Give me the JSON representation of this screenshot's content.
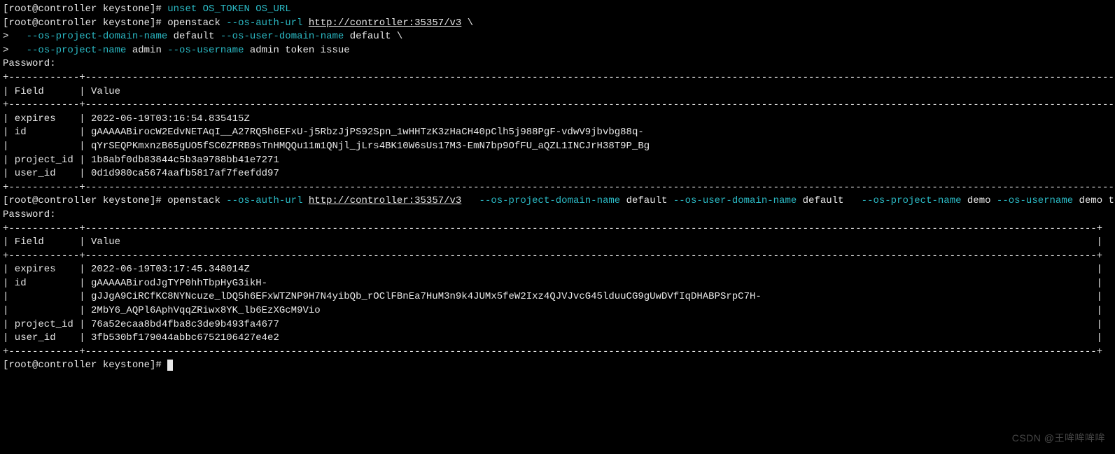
{
  "prompt1": "[root@controller keystone]# ",
  "prompt2": ">   ",
  "cmd_unset": "unset OS_TOKEN OS_URL",
  "cmd1_part1a": "openstack ",
  "cmd1_flag1": "--os-auth-url",
  "cmd1_space1": " ",
  "cmd1_url": "http://controller:35357/v3",
  "cmd1_bs1": " \\",
  "cmd1_flag2": "--os-project-domain-name",
  "cmd1_val2": " default ",
  "cmd1_flag3": "--os-user-domain-name",
  "cmd1_val3": " default \\",
  "cmd1_flag4": "--os-project-name",
  "cmd1_val4": " admin ",
  "cmd1_flag5": "--os-username",
  "cmd1_val5": " admin token issue",
  "password_label": "Password: ",
  "table1": {
    "sep_top": "+------------+-----------------------------------------------------------------------------------------------------------------------------------------------------------------------------------------+",
    "header": "| Field      | Value                                                                                                                                                                                   |",
    "sep_mid": "+------------+-----------------------------------------------------------------------------------------------------------------------------------------------------------------------------------------+",
    "row_exp": "| expires    | 2022-06-19T03:16:54.835415Z                                                                                                                                                             |",
    "row_id1": "| id         | gAAAAABirocW2EdvNETAqI__A27RQ5h6EFxU-j5RbzJjPS92Spn_1wHHTzK3zHaCH40pClh5j988PgF-vdwV9jbvbg88q-                                                                                          |",
    "row_id2": "|            | qYrSEQPKmxnzB65gUO5fSC0ZPRB9sTnHMQQu11m1QNjl_jLrs4BK10W6sUs17M3-EmN7bp9OfFU_aQZL1INCJrH38T9P_Bg                                                                                         |",
    "row_pid": "| project_id | 1b8abf0db83844c5b3a9788bb41e7271                                                                                                                                                        |",
    "row_uid": "| user_id    | 0d1d980ca5674aafb5817af7feefdd97                                                                                                                                                        |",
    "sep_bot": "+------------+-----------------------------------------------------------------------------------------------------------------------------------------------------------------------------------------+"
  },
  "cmd2_part1": "openstack ",
  "cmd2_flag1": "--os-auth-url",
  "cmd2_sp1": " ",
  "cmd2_url": "http://controller:35357/v3",
  "cmd2_sp2": "   ",
  "cmd2_flag2": "--os-project-domain-name",
  "cmd2_val2": " default ",
  "cmd2_flag3": "--os-user-domain-name",
  "cmd2_val3": " default   ",
  "cmd2_flag4": "--os-project-name",
  "cmd2_val4": " demo ",
  "cmd2_flag5": "--os-username",
  "cmd2_val5": " demo token issue",
  "table2": {
    "sep_top": "+------------+----------------------------------------------------------------------------------------------------------------------------------------------------------------------------+",
    "header": "| Field      | Value                                                                                                                                                                      |",
    "sep_mid": "+------------+----------------------------------------------------------------------------------------------------------------------------------------------------------------------------+",
    "row_exp": "| expires    | 2022-06-19T03:17:45.348014Z                                                                                                                                                |",
    "row_id1": "| id         | gAAAAABirodJgTYP0hhTbpHyG3ikH-                                                                                                                                             |",
    "row_id2": "|            | gJJgA9CiRCfKC8NYNcuze_lDQ5h6EFxWTZNP9H7N4yibQb_rOClFBnEa7HuM3n9k4JUMx5feW2Ixz4QJVJvcG45lduuCG9gUwDVfIqDHABPSrpC7H-                                                         |",
    "row_id3": "|            | 2MbY6_AQPl6AphVqqZRiwx8YK_lb6EzXGcM9Vio                                                                                                                                    |",
    "row_pid": "| project_id | 76a52ecaa8bd4fba8c3de9b493fa4677                                                                                                                                           |",
    "row_uid": "| user_id    | 3fb530bf179044abbc6752106427e4e2                                                                                                                                           |",
    "sep_bot": "+------------+----------------------------------------------------------------------------------------------------------------------------------------------------------------------------+"
  },
  "watermark": "CSDN @王哞哞哞哞"
}
